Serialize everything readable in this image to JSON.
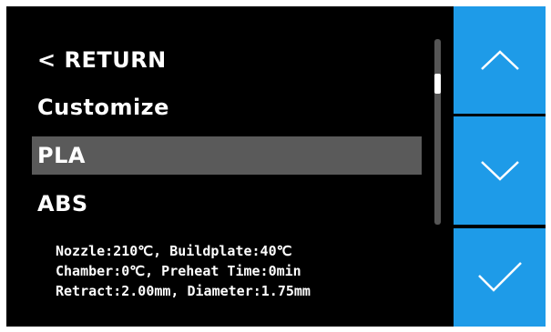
{
  "menu": {
    "items": [
      {
        "label": "< RETURN",
        "selected": false
      },
      {
        "label": "Customize",
        "selected": false
      },
      {
        "label": "PLA",
        "selected": true
      },
      {
        "label": "ABS",
        "selected": false
      }
    ]
  },
  "info": {
    "line1": "Nozzle:210℃, Buildplate:40℃",
    "line2": "Chamber:0℃, Preheat Time:0min",
    "line3": "Retract:2.00mm, Diameter:1.75mm"
  },
  "side_buttons": {
    "up_icon": "chevron-up-icon",
    "down_icon": "chevron-down-icon",
    "confirm_icon": "checkmark-icon"
  },
  "colors": {
    "background": "#000000",
    "selected_row": "#5a5a5a",
    "button_blue": "#1e9be8",
    "text": "#ffffff"
  }
}
